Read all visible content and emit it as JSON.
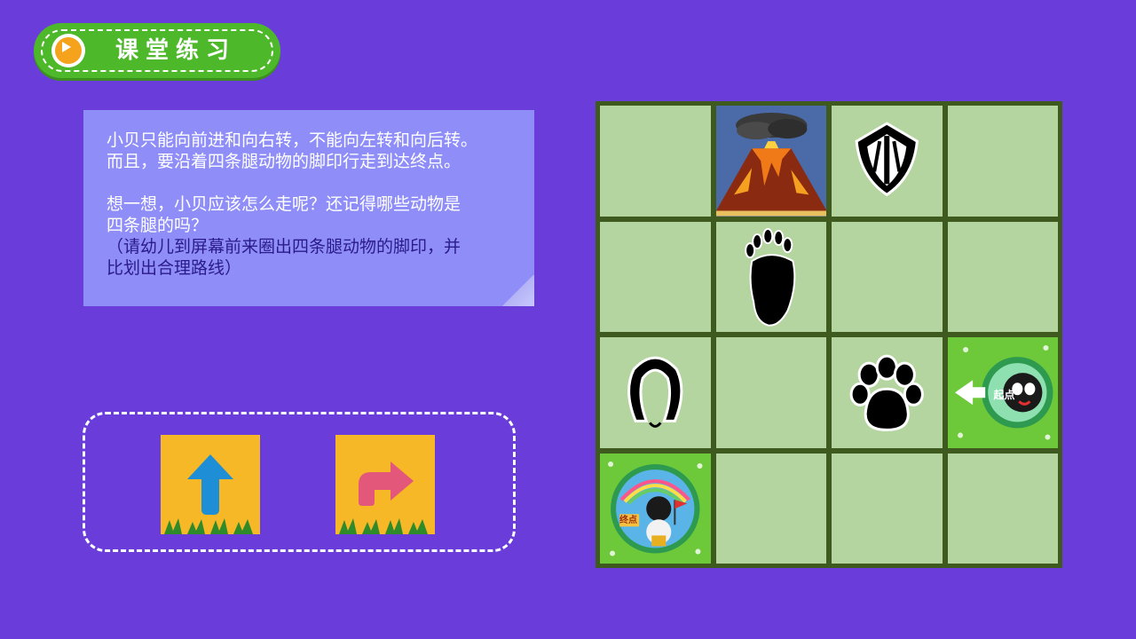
{
  "header": {
    "title": "课堂练习",
    "play_icon": "play-icon"
  },
  "instructions": {
    "line1": "小贝只能向前进和向右转，不能向左转和向后转。",
    "line2": "而且，要沿着四条腿动物的脚印行走到达终点。",
    "line3": "想一想，小贝应该怎么走呢？还记得哪些动物是",
    "line4": "四条腿的吗？",
    "line5": "（请幼儿到屏幕前来圈出四条腿动物的脚印，并",
    "line6": "比划出合理路线）"
  },
  "commands": [
    {
      "name": "forward",
      "icon": "arrow-up-icon",
      "color": "#1e8fd6"
    },
    {
      "name": "turn-right",
      "icon": "arrow-turn-right-icon",
      "color": "#e2577a"
    }
  ],
  "grid": {
    "rows": 4,
    "cols": 4,
    "cells": [
      [
        "empty",
        "volcano",
        "bird-footprint",
        "empty"
      ],
      [
        "empty",
        "bear-footprint",
        "empty",
        "empty"
      ],
      [
        "horse-hoofprint",
        "empty",
        "paw-print",
        "start"
      ],
      [
        "end",
        "empty",
        "empty",
        "empty"
      ]
    ],
    "start_label": "起点",
    "end_label": "终点"
  },
  "colors": {
    "background": "#6a3ddb",
    "title_pill": "#4cb82a",
    "card": "#8f8ef8",
    "grid_border": "#3e5a1e",
    "cell": "#b5d5a0",
    "command_card": "#f6b826"
  }
}
